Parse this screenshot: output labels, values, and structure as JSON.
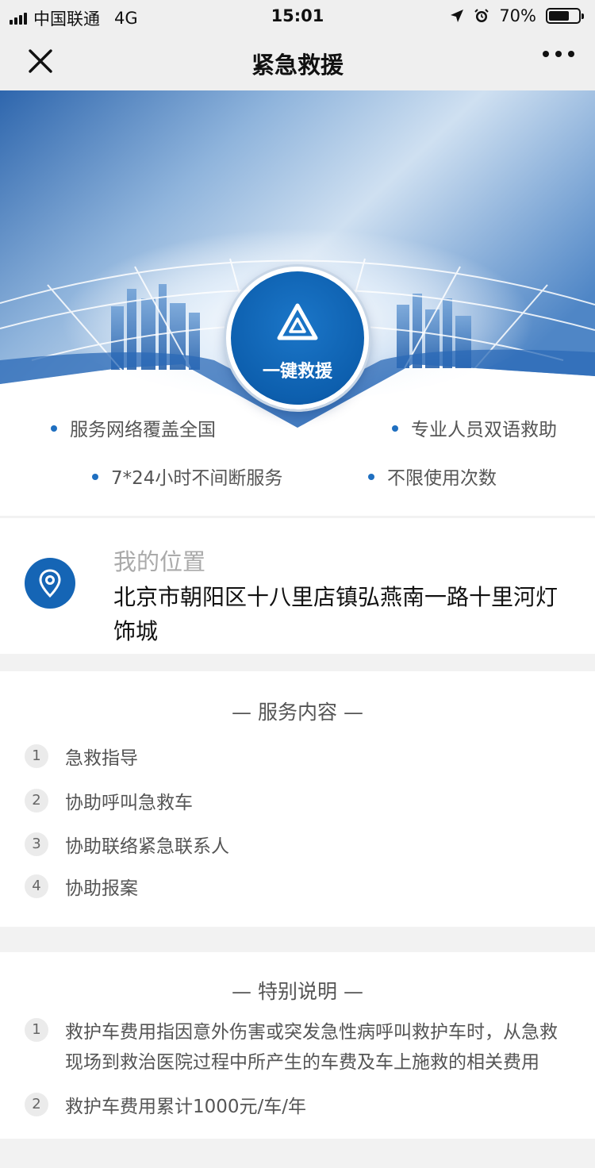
{
  "status_bar": {
    "carrier": "中国联通",
    "network": "4G",
    "time": "15:01",
    "battery": "70%",
    "battery_level": 0.7
  },
  "nav": {
    "title": "紧急救援",
    "close_icon": "close-icon",
    "more_icon": "more-dots-icon"
  },
  "hero": {
    "button_label": "一键救援",
    "button_icon": "warning-triangle-icon",
    "features": [
      "服务网络覆盖全国",
      "专业人员双语救助",
      "7*24小时不间断服务",
      "不限使用次数"
    ]
  },
  "location": {
    "title": "我的位置",
    "address": "北京市朝阳区十八里店镇弘燕南一路十里河灯饰城",
    "icon": "location-pin-icon"
  },
  "services": {
    "title": "— 服务内容 —",
    "items": [
      {
        "num": "1",
        "text": "急救指导"
      },
      {
        "num": "2",
        "text": "协助呼叫急救车"
      },
      {
        "num": "3",
        "text": "协助联络紧急联系人"
      },
      {
        "num": "4",
        "text": "协助报案"
      }
    ]
  },
  "notes": {
    "title": "— 特别说明 —",
    "items": [
      {
        "num": "1",
        "line1": "救护车费用指因意外伤害或突发急性病呼叫救护车时，从急救",
        "line2": "现场到救治医院过程中所产生的车费及车上施救的相关费用"
      },
      {
        "num": "2",
        "line1": "救护车费用累计1000元/车/年",
        "line2": ""
      }
    ]
  },
  "colors": {
    "brand_blue": "#0d5fae",
    "bullet_blue": "#1f6fc0",
    "background": "#f2f2f2"
  }
}
